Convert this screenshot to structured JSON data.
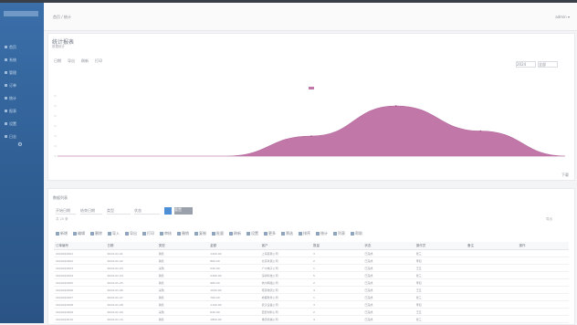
{
  "colors": {
    "sidebar": "#2f5e93",
    "accent": "#4c8fd6",
    "series": "#c178a8",
    "background": "#f3f4f6"
  },
  "sidebar": {
    "logo": "SYSTEM",
    "items": [
      {
        "label": "首页"
      },
      {
        "label": "系统"
      },
      {
        "label": "管理"
      },
      {
        "label": "订单"
      },
      {
        "label": "统计"
      },
      {
        "label": "报表"
      },
      {
        "label": "设置"
      },
      {
        "label": "日志"
      }
    ],
    "settings_icon": "gear-icon"
  },
  "header": {
    "breadcrumb": "首页 / 统计",
    "user": "admin ▾"
  },
  "chart_panel": {
    "title": "统计报表",
    "subtitle": "数据统计",
    "tools": [
      "日期",
      "导出",
      "刷新",
      "打印"
    ],
    "select_left": "2024",
    "select_right": "全部",
    "footer_btn": "下载"
  },
  "chart_data": {
    "type": "area",
    "x": [
      0,
      1,
      2,
      3,
      4,
      5,
      6
    ],
    "tick_labels": [
      "",
      "",
      "",
      "",
      "",
      ""
    ],
    "series": [
      {
        "name": "",
        "values": [
          0,
          0,
          0,
          4,
          10,
          5,
          0
        ]
      }
    ],
    "ylim": [
      0,
      12
    ],
    "grid": false,
    "legend": "top-center"
  },
  "table_panel": {
    "title": "数据列表",
    "filters": [
      "开始日期",
      "结束日期",
      "类型",
      "状态"
    ],
    "search_label": "",
    "reset_label": "重置",
    "hint": "共 20 条",
    "hint_right": "导出",
    "actions": [
      "新增",
      "编辑",
      "删除",
      "导入",
      "导出",
      "打印",
      "审核",
      "撤销",
      "复制",
      "批量",
      "刷新",
      "设置",
      "更多",
      "筛选",
      "排序",
      "统计",
      "列表",
      "帮助"
    ],
    "columns": [
      "订单编号",
      "日期",
      "类型",
      "金额",
      "客户",
      "数量",
      "状态",
      "操作员",
      "备注",
      "操作"
    ],
    "rows": [
      [
        "2024010001",
        "2024-01-01",
        "销售",
        "1200.00",
        "上海贸易公司",
        "3",
        "已完成",
        "张三",
        "",
        ""
      ],
      [
        "2024010002",
        "2024-01-02",
        "销售",
        "860.00",
        "北京商贸公司",
        "2",
        "已完成",
        "李四",
        "",
        ""
      ],
      [
        "2024010003",
        "2024-01-03",
        "采购",
        "540.00",
        "广州电子公司",
        "1",
        "已完成",
        "王五",
        "",
        ""
      ],
      [
        "2024010004",
        "2024-01-04",
        "销售",
        "2300.00",
        "深圳科技公司",
        "5",
        "已完成",
        "张三",
        "",
        ""
      ],
      [
        "2024010005",
        "2024-01-05",
        "销售",
        "980.00",
        "杭州网络公司",
        "2",
        "已完成",
        "李四",
        "",
        ""
      ],
      [
        "2024010006",
        "2024-01-06",
        "采购",
        "1500.00",
        "南京物流公司",
        "4",
        "已完成",
        "王五",
        "",
        ""
      ],
      [
        "2024010007",
        "2024-01-07",
        "销售",
        "760.00",
        "成都软件公司",
        "1",
        "已完成",
        "张三",
        "",
        ""
      ],
      [
        "2024010008",
        "2024-01-08",
        "销售",
        "1100.00",
        "武汉设备公司",
        "3",
        "已完成",
        "李四",
        "",
        ""
      ],
      [
        "2024010009",
        "2024-01-09",
        "采购",
        "640.00",
        "西安材料公司",
        "2",
        "已完成",
        "王五",
        "",
        ""
      ],
      [
        "2024010010",
        "2024-01-10",
        "销售",
        "1850.00",
        "重庆机械公司",
        "4",
        "已完成",
        "张三",
        "",
        ""
      ]
    ]
  }
}
